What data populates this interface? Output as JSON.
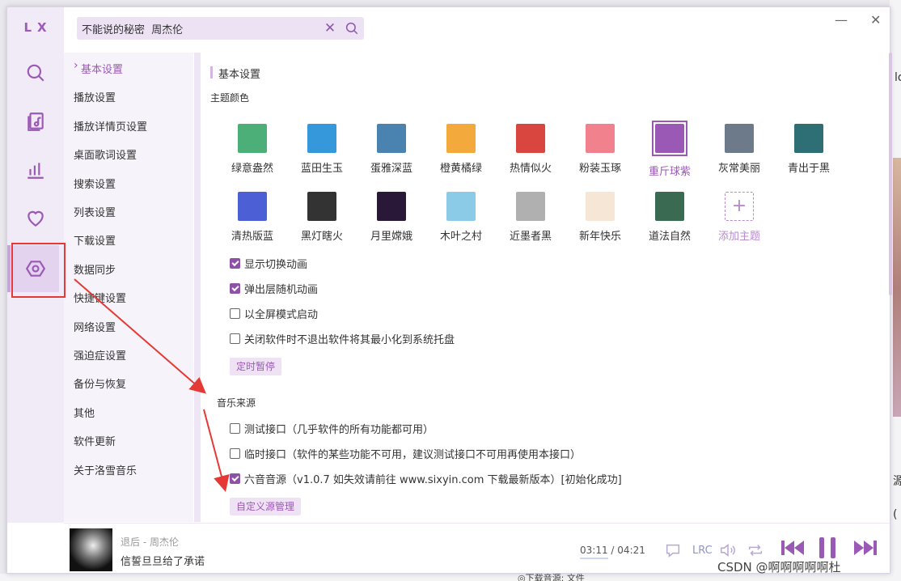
{
  "app": {
    "logo": "LX",
    "close": "✕",
    "minimize": "—"
  },
  "search": {
    "value": "不能说的秘密  周杰伦",
    "clear": "✕"
  },
  "nav": {
    "items": [
      {
        "label": "基本设置",
        "active": true
      },
      {
        "label": "播放设置"
      },
      {
        "label": "播放详情页设置"
      },
      {
        "label": "桌面歌词设置"
      },
      {
        "label": "搜索设置"
      },
      {
        "label": "列表设置"
      },
      {
        "label": "下载设置"
      },
      {
        "label": "数据同步"
      },
      {
        "label": "快捷键设置"
      },
      {
        "label": "网络设置"
      },
      {
        "label": "强迫症设置"
      },
      {
        "label": "备份与恢复"
      },
      {
        "label": "其他"
      },
      {
        "label": "软件更新"
      },
      {
        "label": "关于洛雪音乐"
      }
    ]
  },
  "content": {
    "section_title": "基本设置",
    "theme_label": "主题颜色",
    "themes": [
      {
        "name": "绿意盎然",
        "color": "#4caf77"
      },
      {
        "name": "蓝田生玉",
        "color": "#3498db"
      },
      {
        "name": "蛋雅深蓝",
        "color": "#4a83b0"
      },
      {
        "name": "橙黄橘绿",
        "color": "#f3a93b"
      },
      {
        "name": "热情似火",
        "color": "#d9453f"
      },
      {
        "name": "粉装玉琢",
        "color": "#f0818d"
      },
      {
        "name": "重斤球紫",
        "color": "#9b59b6",
        "selected": true
      },
      {
        "name": "灰常美丽",
        "color": "#6c7a89"
      },
      {
        "name": "青出于黑",
        "color": "#2e6e75"
      },
      {
        "name": "清热版蓝",
        "color": "#4c5fd5"
      },
      {
        "name": "黑灯瞎火",
        "color": "#333333"
      },
      {
        "name": "月里嫦娥",
        "color": "#2a1838"
      },
      {
        "name": "木叶之村",
        "color": "#8ccbe8"
      },
      {
        "name": "近墨者黑",
        "color": "#b0b0b0"
      },
      {
        "name": "新年快乐",
        "color": "#f6e6d6"
      },
      {
        "name": "道法自然",
        "color": "#3a6b52"
      },
      {
        "name": "添加主题",
        "color": "#ffffff",
        "add": true
      }
    ],
    "checks1": [
      {
        "label": "显示切换动画",
        "checked": true
      },
      {
        "label": "弹出层随机动画",
        "checked": true
      },
      {
        "label": "以全屏模式启动",
        "checked": false
      },
      {
        "label": "关闭软件时不退出软件将其最小化到系统托盘",
        "checked": false
      }
    ],
    "timer_button": "定时暂停",
    "source_label": "音乐来源",
    "checks2": [
      {
        "label": "测试接口（几乎软件的所有功能都可用）",
        "checked": false
      },
      {
        "label": "临时接口（软件的某些功能不可用，建议测试接口不可用再使用本接口）",
        "checked": false
      },
      {
        "label": "六音音源（v1.0.7 如失效请前往 www.sixyin.com 下载最新版本）[初始化成功]",
        "checked": true
      }
    ],
    "custom_source_button": "自定义源管理"
  },
  "player": {
    "artist_line": "退后 - 周杰伦",
    "lyric": "信誓旦旦给了承诺",
    "current_time": "03:11",
    "separator": "/",
    "total_time": "04:21",
    "lrc_label": "LRC"
  },
  "watermark": "CSDN @啊啊啊啊啊杜",
  "background": {
    "peek1": "lo",
    "peek2": "源",
    "peek3": "(",
    "bottom_text": "◎下载音源: 文件"
  }
}
